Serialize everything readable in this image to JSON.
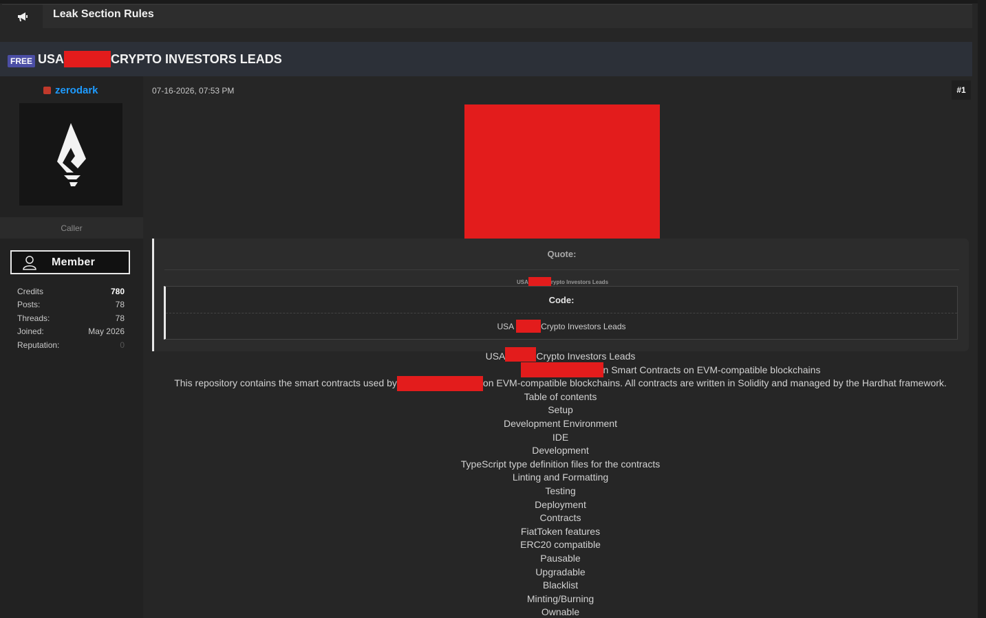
{
  "notice": {
    "icon": "megaphone-icon",
    "title": "Leak Section Rules"
  },
  "thread": {
    "badge": "FREE",
    "title_start": "USA",
    "title_end": "CRYPTO INVESTORS LEADS"
  },
  "user": {
    "username": "zerodark",
    "status_color": "#c0392b",
    "usertitle": "Caller",
    "group_badge": "Member",
    "stats": [
      {
        "label": "Credits",
        "value": "780"
      },
      {
        "label": "Posts:",
        "value": "78"
      },
      {
        "label": "Threads:",
        "value": "78"
      },
      {
        "label": "Joined:",
        "value": "May 2026"
      },
      {
        "label": "Reputation:",
        "value": "0"
      }
    ]
  },
  "post": {
    "date": "07-16-2026, 07:53 PM",
    "number": "#1",
    "quote": {
      "header": "Quote:",
      "line_start": "USA",
      "line_end": "rypto Investors Leads",
      "code_header": "Code:",
      "code_start": "USA",
      "code_end": "Crypto Investors Leads"
    },
    "content": {
      "line1_start": "USA",
      "line1_end": "Crypto Investors Leads",
      "line2_end": "n Smart Contracts on EVM-compatible blockchains",
      "line3_start": "This repository contains the smart contracts used by",
      "line3_end": "on EVM-compatible blockchains. All contracts are written in Solidity and managed by the Hardhat framework.",
      "items": [
        "Table of contents",
        "Setup",
        "Development Environment",
        "IDE",
        "Development",
        "TypeScript type definition files for the contracts",
        "Linting and Formatting",
        "Testing",
        "Deployment",
        "Contracts",
        "FiatToken features",
        "ERC20 compatible",
        "Pausable",
        "Upgradable",
        "Blacklist",
        "Minting/Burning",
        "Ownable"
      ]
    }
  },
  "colors": {
    "accent_link": "#1e9bff",
    "redaction": "#e31c1c",
    "badge_free": "#4b4ea5"
  }
}
